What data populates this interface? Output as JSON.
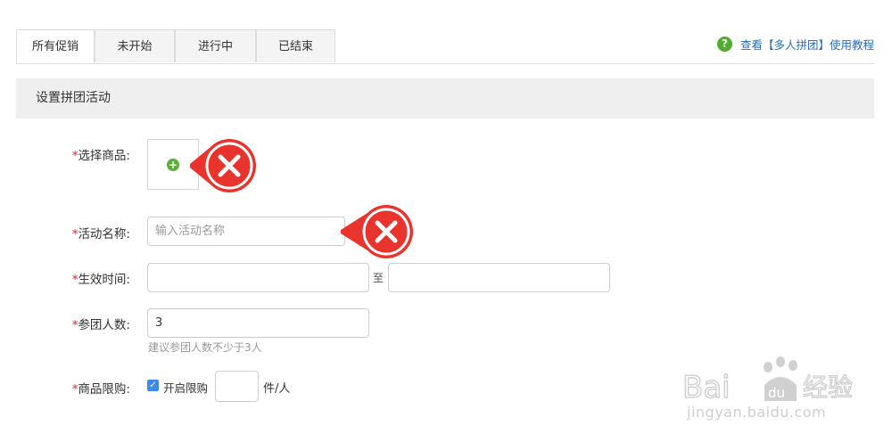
{
  "tabs": [
    {
      "label": "所有促销",
      "active": true
    },
    {
      "label": "未开始",
      "active": false
    },
    {
      "label": "进行中",
      "active": false
    },
    {
      "label": "已结束",
      "active": false
    }
  ],
  "help": {
    "icon": "question-icon",
    "icon_text": "?",
    "text": "查看【多人拼团】使用教程"
  },
  "section": {
    "title": "设置拼团活动"
  },
  "form": {
    "required_mark": "*",
    "product": {
      "label": "选择商品:",
      "add_icon": "plus-icon",
      "add_glyph": "+"
    },
    "name": {
      "label": "活动名称:",
      "placeholder": "输入活动名称",
      "value": ""
    },
    "time": {
      "label": "生效时间:",
      "start_value": "",
      "to_text": "至",
      "end_value": ""
    },
    "members": {
      "label": "参团人数:",
      "value": "3",
      "hint": "建议参团人数不少于3人"
    },
    "limit": {
      "label": "商品限购:",
      "checkbox_checked": true,
      "checkbox_label": "开启限购",
      "value": "",
      "unit": "件/人"
    }
  },
  "callouts": [
    {
      "icon": "close-icon",
      "color": "#e8342c"
    },
    {
      "icon": "close-icon",
      "color": "#e8342c"
    }
  ],
  "watermark": {
    "logo_text": "Bai du 经验",
    "url_text": "jingyan.baidu.com"
  },
  "colors": {
    "accent_green": "#51ad2e",
    "link_blue": "#2a6db5",
    "required_red": "#d9262b",
    "checkbox_blue": "#3b8be6"
  }
}
